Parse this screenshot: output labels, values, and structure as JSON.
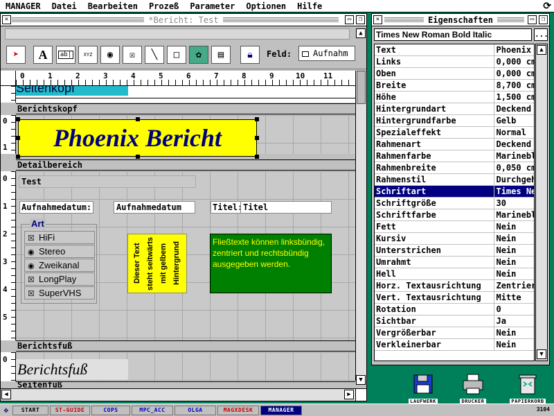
{
  "menubar": {
    "items": [
      "MANAGER",
      "Datei",
      "Bearbeiten",
      "Prozeß",
      "Parameter",
      "Optionen",
      "Hilfe"
    ]
  },
  "report_window": {
    "title": "*Bericht: Test",
    "toolbar": {
      "feld_label": "Feld:",
      "feld_value": "Aufnahm"
    },
    "ruler_numbers": [
      "0",
      "1",
      "2",
      "3",
      "4",
      "5",
      "6",
      "7",
      "8",
      "9",
      "10",
      "11"
    ],
    "sections": {
      "seitenkopf": "Seitenkopf",
      "berichtskopf": "Berichtskopf",
      "detailbereich": "Detailbereich",
      "berichtsfuss": "Berichtsfuß",
      "seitenfuss": "Seitenfuß"
    },
    "berichtskopf_text": "Phoenix Bericht",
    "detail": {
      "test_field": "Test",
      "aufnahmedatum_label": "Aufnahmedatum:",
      "aufnahmedatum_field": "Aufnahmedatum",
      "titel_label": "Titel:",
      "titel_field": "Titel",
      "art_title": "Art",
      "art_options": [
        {
          "mark": "☒",
          "label": "HiFi"
        },
        {
          "mark": "◉",
          "label": "Stereo"
        },
        {
          "mark": "◉",
          "label": "Zweikanal"
        },
        {
          "mark": "☒",
          "label": "LongPlay"
        },
        {
          "mark": "☒",
          "label": "SuperVHS"
        }
      ],
      "vertical_text": "Dieser Text steht seitwärts mit gelbem Hintergrund",
      "green_text": "Fließtexte können linksbündig, zentriert und rechtsbündig ausgegeben werden."
    },
    "footer_text": "Berichtsfuß",
    "vruler_numbers": {
      "kopf": [
        "0",
        "1"
      ],
      "detail": [
        "0",
        "1",
        "2",
        "3",
        "4",
        "5"
      ],
      "fuss": [
        "0"
      ]
    }
  },
  "properties_window": {
    "title": "Eigenschaften",
    "font_value": "Times New Roman Bold Italic",
    "more_button": "...",
    "rows": [
      {
        "key": "Text",
        "value": "Phoenix Bericht"
      },
      {
        "key": "Links",
        "value": "0,000 cm"
      },
      {
        "key": "Oben",
        "value": "0,000 cm"
      },
      {
        "key": "Breite",
        "value": "8,700 cm"
      },
      {
        "key": "Höhe",
        "value": "1,500 cm"
      },
      {
        "key": "Hintergrundart",
        "value": "Deckend"
      },
      {
        "key": "Hintergrundfarbe",
        "value": "Gelb"
      },
      {
        "key": "Spezialeffekt",
        "value": "Normal"
      },
      {
        "key": "Rahmenart",
        "value": "Deckend"
      },
      {
        "key": "Rahmenfarbe",
        "value": "Marineblau"
      },
      {
        "key": "Rahmenbreite",
        "value": "0,050 cm"
      },
      {
        "key": "Rahmenstil",
        "value": "Durchgehend"
      },
      {
        "key": "Schriftart",
        "value": "Times New Roman",
        "selected": true
      },
      {
        "key": "Schriftgröße",
        "value": "30"
      },
      {
        "key": "Schriftfarbe",
        "value": "Marineblau"
      },
      {
        "key": "Fett",
        "value": "Nein"
      },
      {
        "key": "Kursiv",
        "value": "Nein"
      },
      {
        "key": "Unterstrichen",
        "value": "Nein"
      },
      {
        "key": "Umrahmt",
        "value": "Nein"
      },
      {
        "key": "Hell",
        "value": "Nein"
      },
      {
        "key": "Horz. Textausrichtung",
        "value": "Zentriert"
      },
      {
        "key": "Vert. Textausrichtung",
        "value": "Mitte"
      },
      {
        "key": "Rotation",
        "value": "0"
      },
      {
        "key": "Sichtbar",
        "value": "Ja"
      },
      {
        "key": "Vergrößerbar",
        "value": "Nein"
      },
      {
        "key": "Verkleinerbar",
        "value": "Nein"
      }
    ]
  },
  "desktop_icons": [
    {
      "name": "floppy-icon",
      "label": "LAUFWERK"
    },
    {
      "name": "printer-icon",
      "label": "DRUCKER"
    },
    {
      "name": "trash-icon",
      "label": "PAPIERKORB"
    }
  ],
  "taskbar": {
    "tasks": [
      {
        "label": "START",
        "color": "#000000"
      },
      {
        "label": "ST-GUIDE",
        "color": "#cc0000"
      },
      {
        "label": "COPS",
        "color": "#0000cc"
      },
      {
        "label": "MPC_ACC",
        "color": "#0000cc"
      },
      {
        "label": "OLGA",
        "color": "#0000cc"
      },
      {
        "label": "MAGXDESK",
        "color": "#cc0000"
      },
      {
        "label": "MANAGER",
        "color": "#ffffff",
        "active": true
      }
    ],
    "clock": "3104"
  },
  "colors": {
    "desktop": "#00805a",
    "title_text": "#000080",
    "highlight": "#ffff00",
    "selection": "#000080"
  }
}
